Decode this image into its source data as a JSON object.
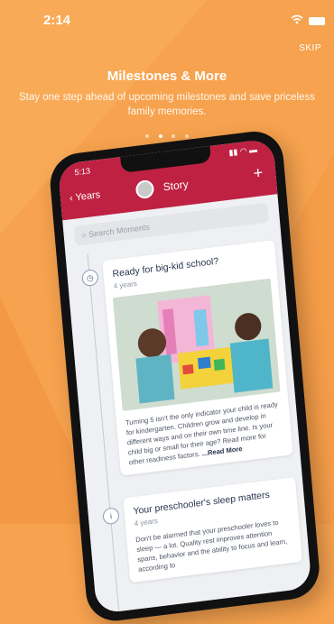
{
  "status_bar": {
    "time": "2:14"
  },
  "skip_label": "SKIP",
  "headline": "Milestones & More",
  "subtitle": "Stay one step ahead of upcoming milestones and save priceless family memories.",
  "pagination": {
    "count": 4,
    "active": 1
  },
  "phone": {
    "status_time": "5:13",
    "back_label": "Years",
    "title": "Story",
    "add_icon": "plus-icon",
    "search_placeholder": "Search Moments",
    "cards": [
      {
        "title": "Ready for big-kid school?",
        "age": "4 years",
        "body": "Turning 5 isn't the only indicator your child is ready for kindergarten. Children grow and develop in different ways and on their own time line. Is your child big or small for their age? Read more for other readiness factors.",
        "more_label": "...Read More",
        "icon": "milestone-icon"
      },
      {
        "title": "Your preschooler's sleep matters",
        "age": "4 years",
        "body": "Don't be alarmed that your preschooler loves to sleep — a lot. Quality rest improves attention spans, behavior and the ability to focus and learn, according to",
        "icon": "info-icon"
      }
    ]
  },
  "colors": {
    "background": "#f6a24e",
    "brand": "#bf2142"
  }
}
